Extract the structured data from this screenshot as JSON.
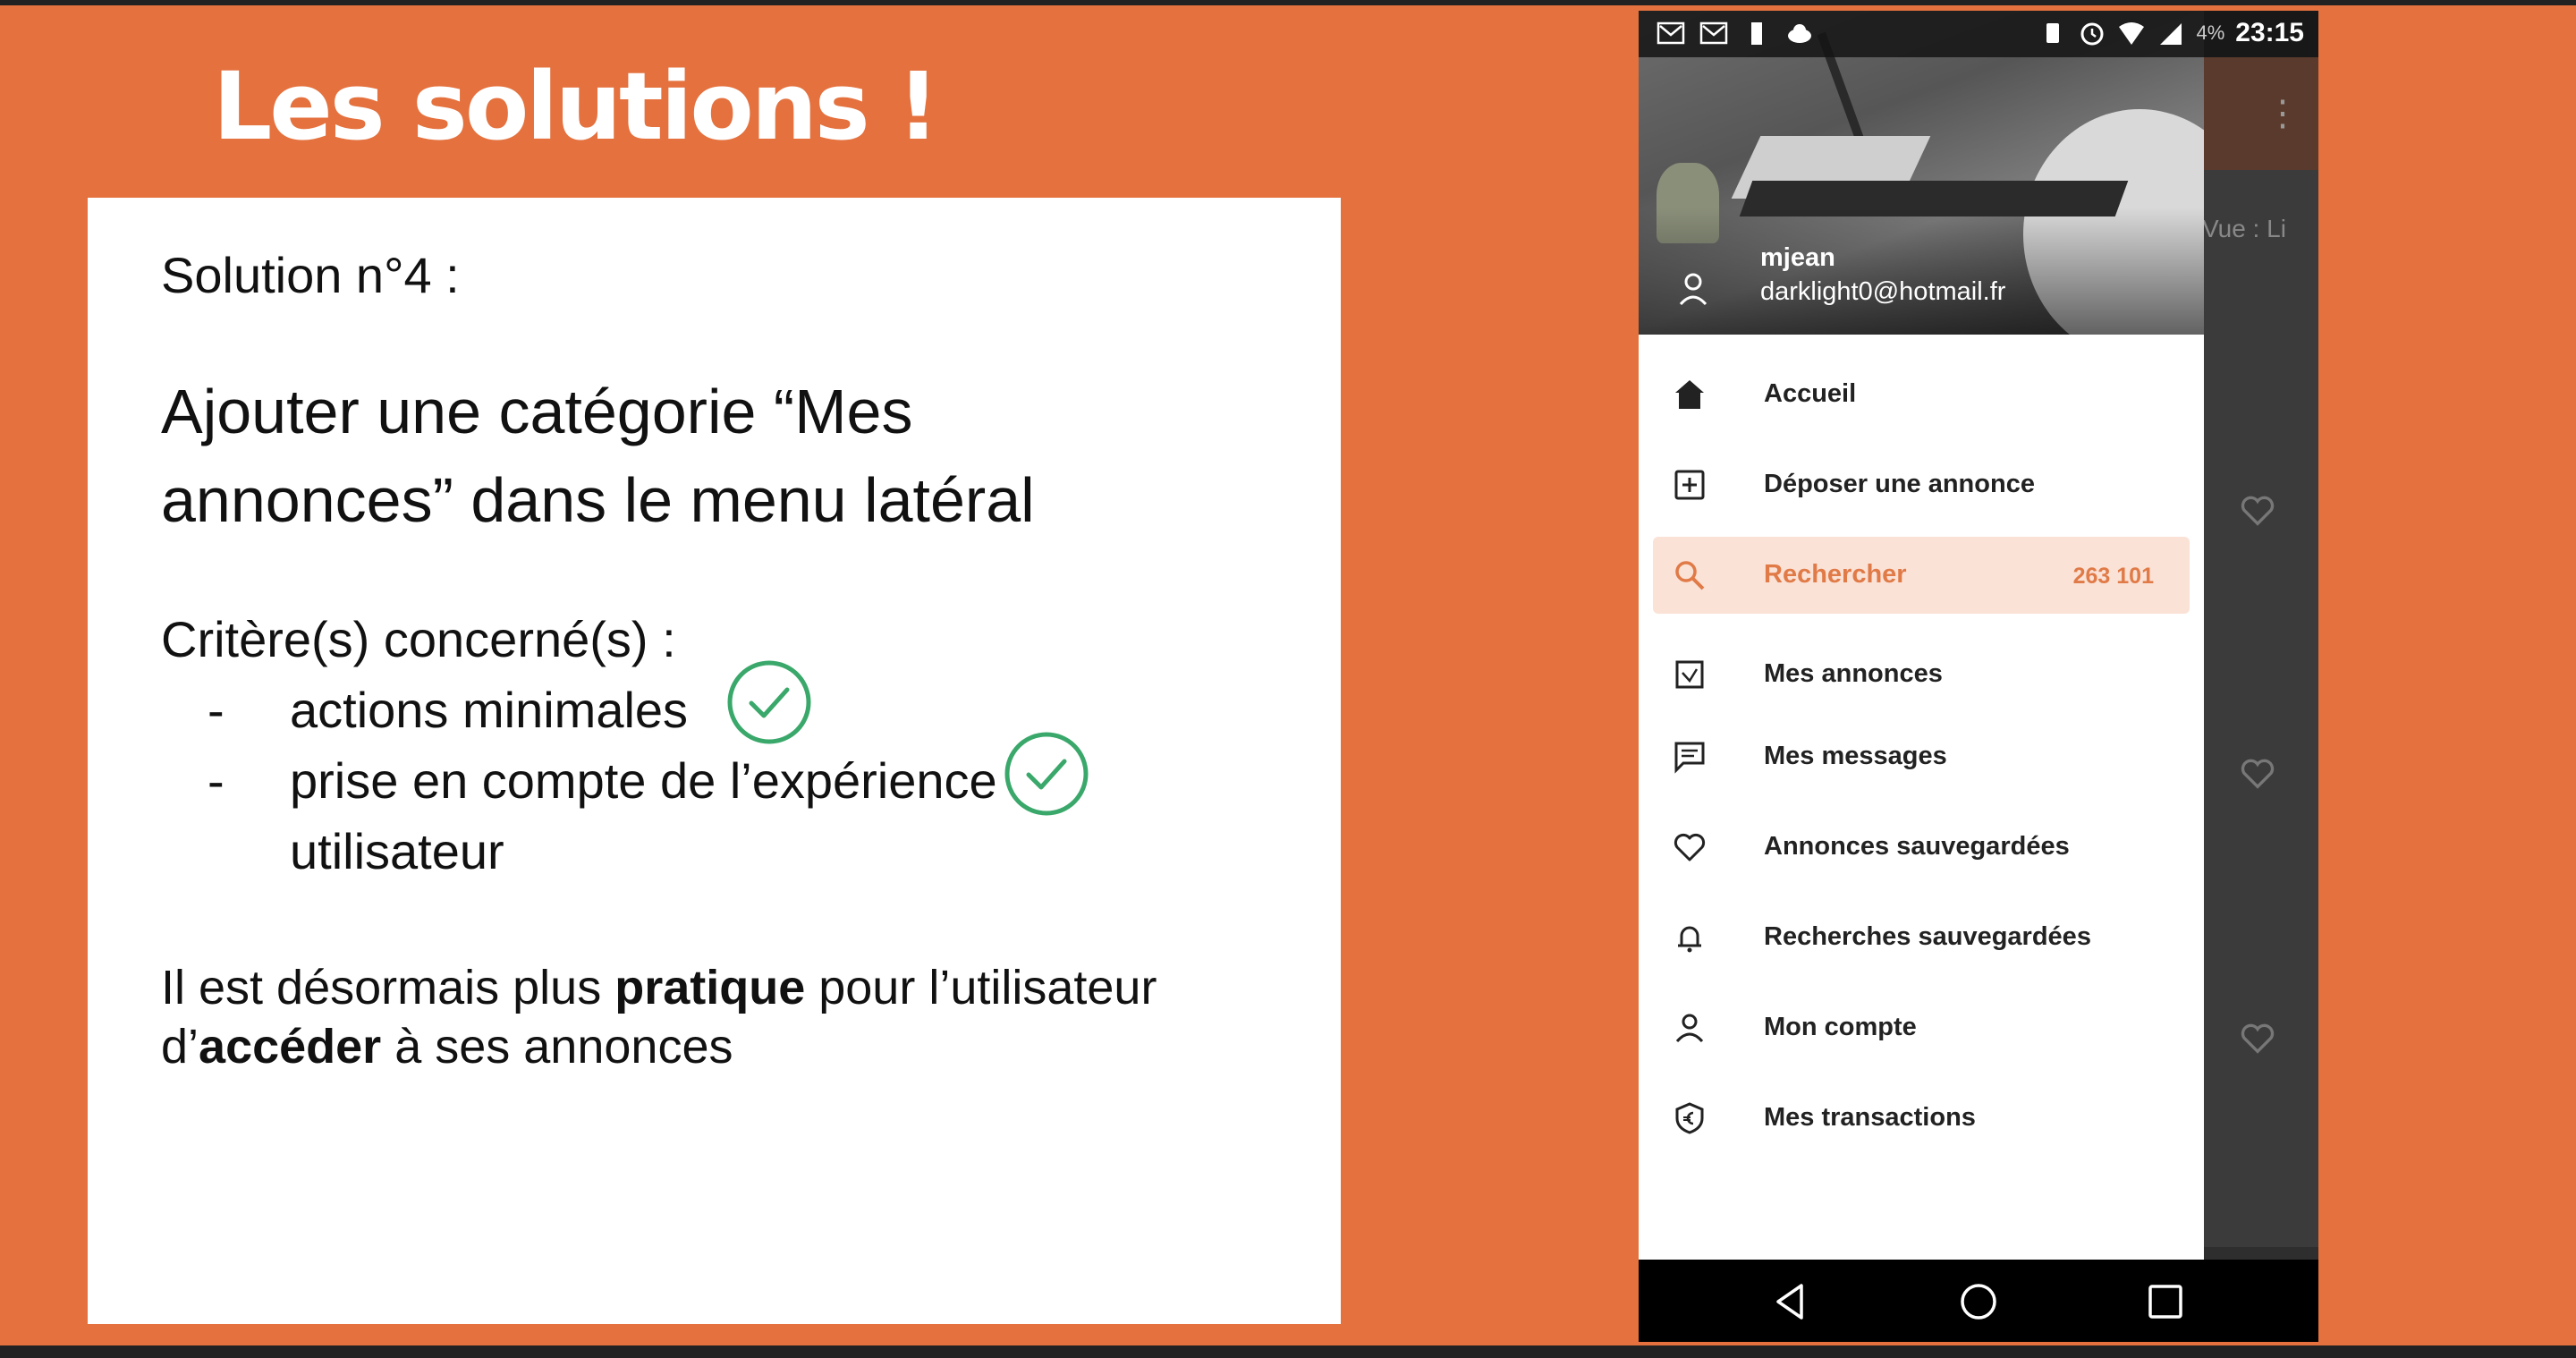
{
  "slide": {
    "title": "Les solutions !",
    "solution_number": "Solution n°4 :",
    "main_line1": "Ajouter une catégorie “Mes",
    "main_line2": "annonces” dans le menu latéral",
    "criteria_heading": "Critère(s) concerné(s) :",
    "criteria": [
      {
        "dash": "-",
        "text": "actions minimales"
      },
      {
        "dash": "-",
        "text": "prise en compte de l’expérience"
      }
    ],
    "criteria_continuation": "utilisateur",
    "summary": {
      "part1": "Il est désormais plus ",
      "bold1": "pratique",
      "part2": " pour l’utilisateur",
      "part3": "d’",
      "bold2": "accéder",
      "part4": " à ses annonces"
    }
  },
  "phone": {
    "status": {
      "time": "23:15",
      "battery": "4%"
    },
    "user": {
      "name": "mjean",
      "email": "darklight0@hotmail.fr"
    },
    "menu": [
      {
        "label": "Accueil",
        "icon": "home-icon"
      },
      {
        "label": "Déposer une annonce",
        "icon": "add-box-icon"
      },
      {
        "label": "Rechercher",
        "icon": "search-icon",
        "count": "263 101",
        "active": true
      },
      {
        "label": "Mes annonces",
        "icon": "annonces-icon"
      },
      {
        "label": "Mes messages",
        "icon": "message-icon"
      },
      {
        "label": "Annonces sauvegardées",
        "icon": "heart-icon"
      },
      {
        "label": "Recherches sauvegardées",
        "icon": "bell-icon"
      },
      {
        "label": "Mon compte",
        "icon": "person-icon"
      },
      {
        "label": "Mes transactions",
        "icon": "shield-euro-icon"
      }
    ],
    "behind_text": "Vue : Li"
  },
  "colors": {
    "background": "#e4713e",
    "check": "#3aa86a",
    "active_text": "#e07a47",
    "active_bg": "#fbe2d6"
  }
}
